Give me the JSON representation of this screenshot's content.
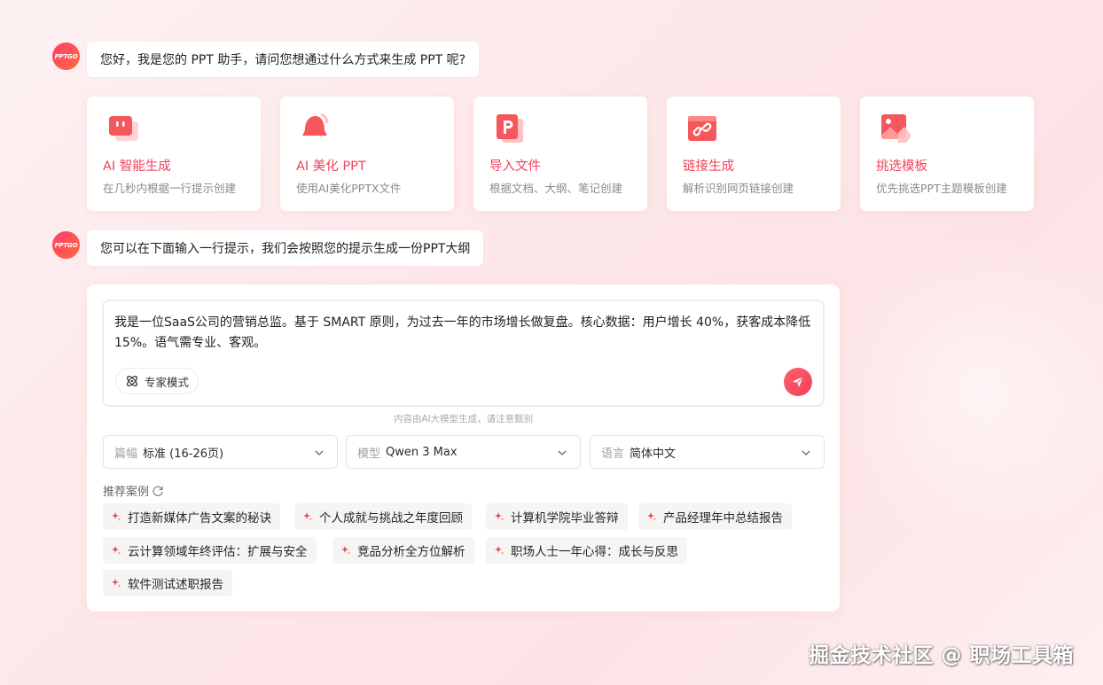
{
  "assistant": {
    "avatar_text": "PPTGO",
    "greeting": "您好，我是您的 PPT 助手，请问您想通过什么方式来生成 PPT 呢?",
    "hint": "您可以在下面输入一行提示，我们会按照您的提示生成一份PPT大纲"
  },
  "cards": [
    {
      "title": "AI 智能生成",
      "desc": "在几秒内根据一行提示创建",
      "icon": "chat-icon"
    },
    {
      "title": "AI 美化 PPT",
      "desc": "使用AI美化PPTX文件",
      "icon": "bell-sparkle-icon"
    },
    {
      "title": "导入文件",
      "desc": "根据文档、大纲、笔记创建",
      "icon": "ppt-file-icon"
    },
    {
      "title": "链接生成",
      "desc": "解析识别网页链接创建",
      "icon": "link-icon"
    },
    {
      "title": "挑选模板",
      "desc": "优先挑选PPT主题模板创建",
      "icon": "image-template-icon"
    }
  ],
  "input": {
    "prompt": "我是一位SaaS公司的营销总监。基于 SMART 原则，为过去一年的市场增长做复盘。核心数据：用户增长 40%，获客成本降低 15%。语气需专业、客观。",
    "expert_mode_label": "专家模式",
    "disclaimer": "内容由AI大模型生成，请注意甄别"
  },
  "selects": [
    {
      "label": "篇幅",
      "value": "标准 (16-26页)"
    },
    {
      "label": "模型",
      "value": "Qwen 3 Max"
    },
    {
      "label": "语言",
      "value": "简体中文"
    }
  ],
  "cases_title": "推荐案例",
  "cases": [
    "打造新媒体广告文案的秘诀",
    "个人成就与挑战之年度回顾",
    "计算机学院毕业答辩",
    "产品经理年中总结报告",
    "云计算领域年终评估：扩展与安全",
    "竞品分析全方位解析",
    "职场人士一年心得：成长与反思",
    "软件测试述职报告"
  ],
  "watermark": "掘金技术社区 @ 职场工具箱",
  "colors": {
    "accent": "#f0425a",
    "background": "#fde6e8"
  }
}
